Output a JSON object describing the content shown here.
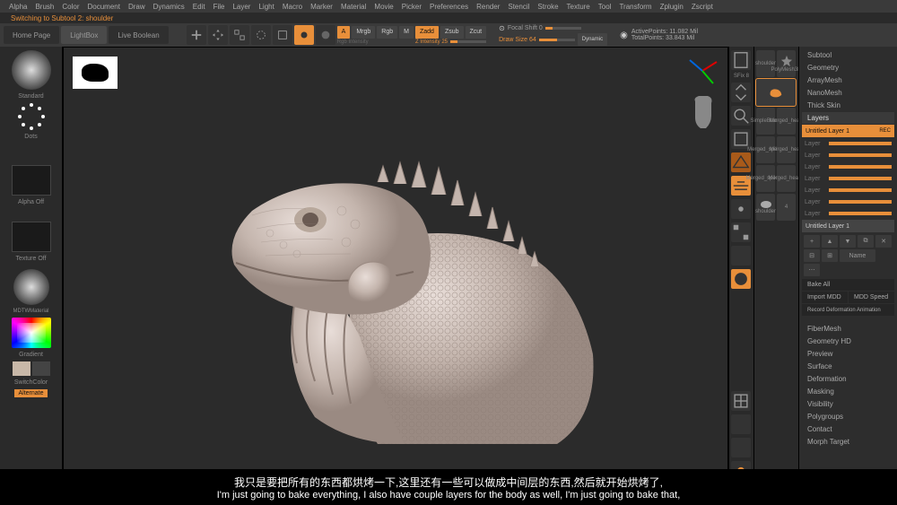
{
  "menu": [
    "Alpha",
    "Brush",
    "Color",
    "Document",
    "Draw",
    "Dynamics",
    "Edit",
    "File",
    "Layer",
    "Light",
    "Macro",
    "Marker",
    "Material",
    "Movie",
    "Picker",
    "Preferences",
    "Render",
    "Stencil",
    "Stroke",
    "Texture",
    "Tool",
    "Transform",
    "Zplugin",
    "Zscript"
  ],
  "status_line": "Switching to Subtool 2: shoulder",
  "header": {
    "home": "Home Page",
    "lightbox": "LightBox",
    "live_boolean": "Live Boolean",
    "edit": "Edit",
    "draw": "Draw",
    "mrgb_label": "Mrgb",
    "rgb_label": "Rgb",
    "m_label": "M",
    "zadd_label": "Zadd",
    "zsub_label": "Zsub",
    "zcut_label": "Zcut",
    "rgb_intensity": "Rgb Intensity",
    "z_intensity": "Z Intensity 25",
    "focal_shift": "Focal Shift 0",
    "draw_size": "Draw Size 64",
    "dynamic": "Dynamic",
    "active_points": "ActivePoints: 11.082 Mil",
    "total_points": "TotalPoints: 33.843 Mil"
  },
  "left": {
    "brush": "Standard",
    "dots": "Dots",
    "alpha_off": "Alpha Off",
    "texture_off": "Texture Off",
    "material": "MDTWMaterial",
    "gradient": "Gradient",
    "switch": "SwitchColor",
    "alternate": "Alternate"
  },
  "right_rail": {
    "sfix": "SFix 8"
  },
  "tool_col": {
    "simple_brush": "SimpleBrush",
    "merged_head": "Merged_head",
    "merged_spikes": "Merged_spikes",
    "merged_head2": "Merged_head",
    "merged_spikes2": "Merged_spikes2",
    "merged_head1": "Merged_head1",
    "shoulder": "shoulder",
    "four": "4",
    "polymesh": "PolyMesh3D",
    "shoulder_top": "shoulder"
  },
  "panel": {
    "subtool": "Subtool",
    "geometry": "Geometry",
    "arraymesh": "ArrayMesh",
    "nanomesh": "NanoMesh",
    "thickskin": "Thick Skin",
    "layers": "Layers",
    "untitled1": "Untitled Layer 1",
    "rec": "REC",
    "layer": "Layer",
    "untitled2": "Untitled Layer 1",
    "name_btn": "Name",
    "bake_all": "Bake All",
    "import_mdd": "Import MDD",
    "mdd_speed": "MDD Speed",
    "record_def": "Record Deformation Animation",
    "fibermesh": "FiberMesh",
    "geohd": "Geometry HD",
    "preview": "Preview",
    "surface": "Surface",
    "deformation": "Deformation",
    "masking": "Masking",
    "visibility": "Visibility",
    "polygroups": "Polygroups",
    "contact": "Contact",
    "morph": "Morph Target"
  },
  "subtitle": {
    "cn": "我只是要把所有的东西都烘烤一下,这里还有一些可以做成中间层的东西,然后就开始烘烤了,",
    "en": "I'm just going to bake everything, I also have couple layers for the body as well, I'm just going to bake that,"
  }
}
